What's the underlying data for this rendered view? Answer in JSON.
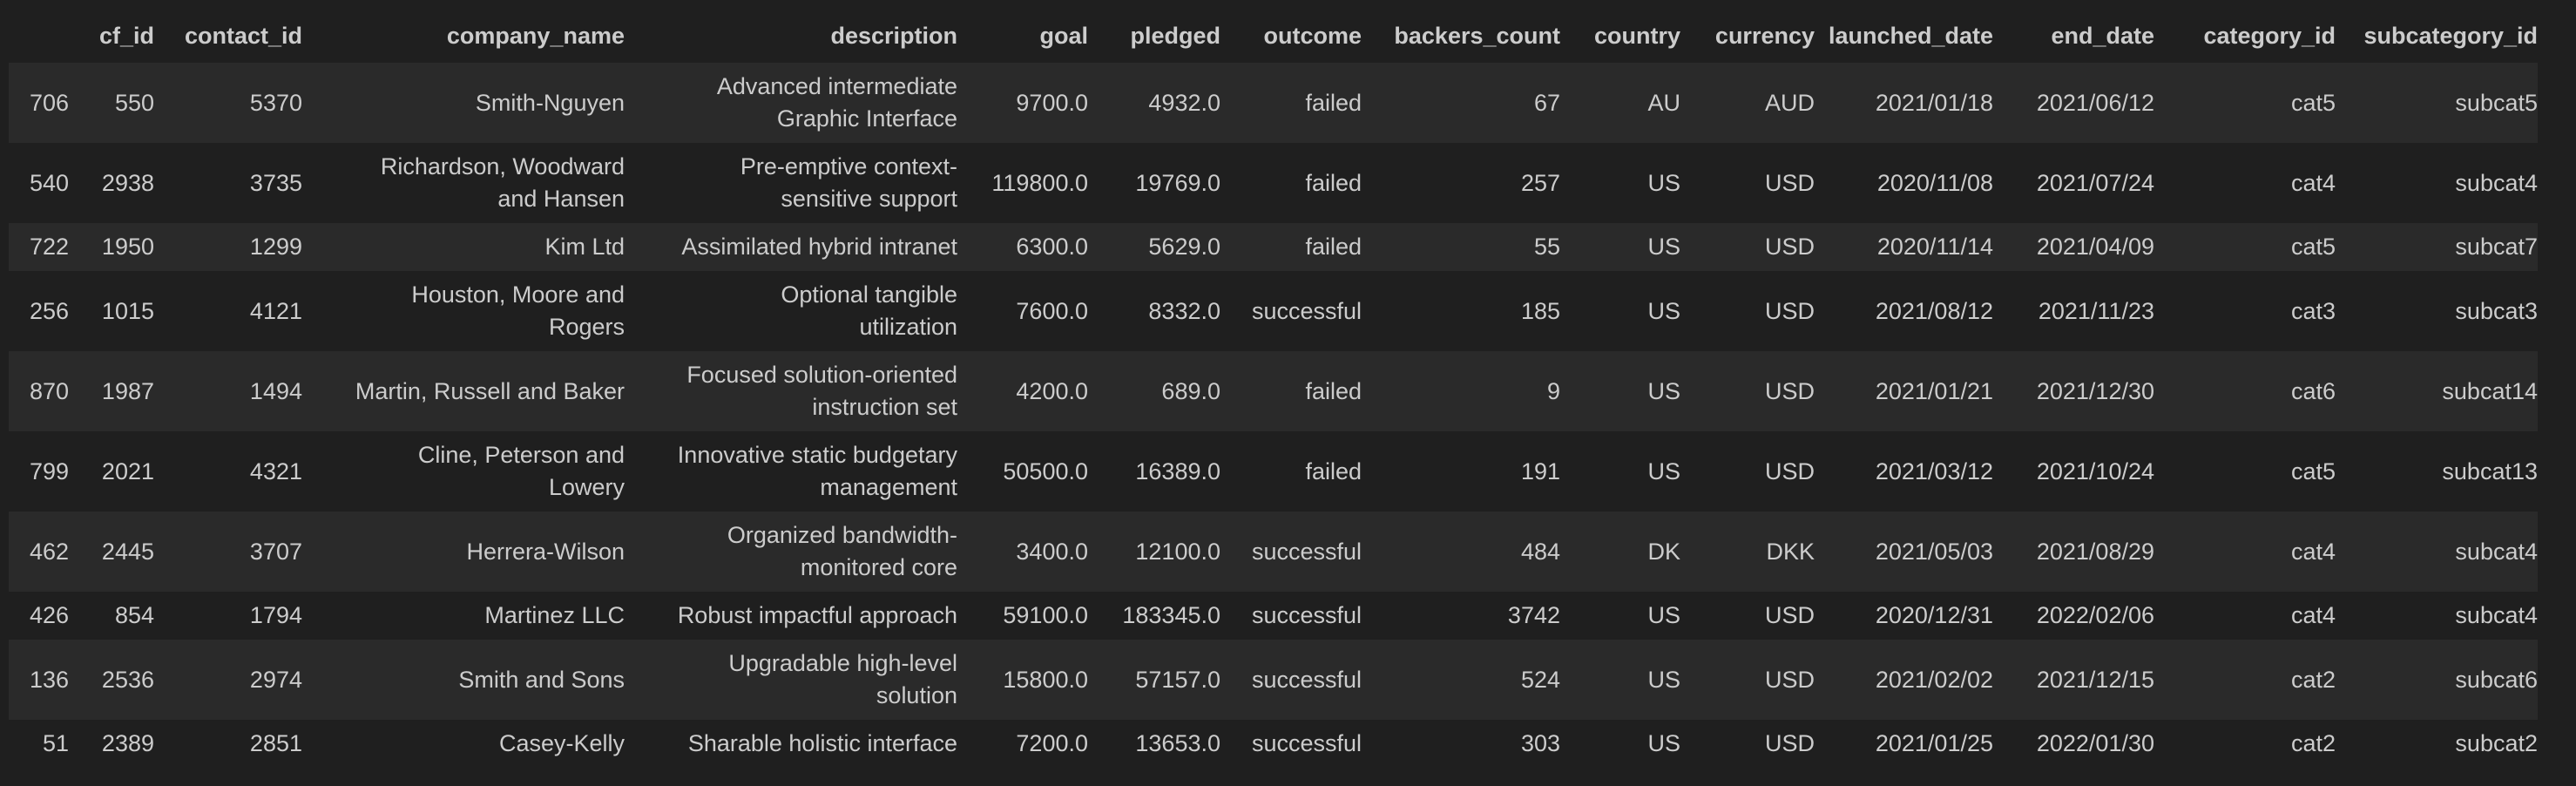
{
  "columns": {
    "index": "",
    "cf_id": "cf_id",
    "contact_id": "contact_id",
    "company_name": "company_name",
    "description": "description",
    "goal": "goal",
    "pledged": "pledged",
    "outcome": "outcome",
    "backers_count": "backers_count",
    "country": "country",
    "currency": "currency",
    "launched_date": "launched_date",
    "end_date": "end_date",
    "category_id": "category_id",
    "subcategory_id": "subcategory_id"
  },
  "rows": [
    {
      "index": "706",
      "cf_id": "550",
      "contact_id": "5370",
      "company_name": [
        "Smith-Nguyen"
      ],
      "description": [
        "Advanced intermediate",
        "Graphic Interface"
      ],
      "goal": "9700.0",
      "pledged": "4932.0",
      "outcome": "failed",
      "backers_count": "67",
      "country": "AU",
      "currency": "AUD",
      "launched_date": "2021/01/18",
      "end_date": "2021/06/12",
      "category_id": "cat5",
      "subcategory_id": "subcat5"
    },
    {
      "index": "540",
      "cf_id": "2938",
      "contact_id": "3735",
      "company_name": [
        "Richardson, Woodward",
        "and Hansen"
      ],
      "description": [
        "Pre-emptive context-",
        "sensitive support"
      ],
      "goal": "119800.0",
      "pledged": "19769.0",
      "outcome": "failed",
      "backers_count": "257",
      "country": "US",
      "currency": "USD",
      "launched_date": "2020/11/08",
      "end_date": "2021/07/24",
      "category_id": "cat4",
      "subcategory_id": "subcat4"
    },
    {
      "index": "722",
      "cf_id": "1950",
      "contact_id": "1299",
      "company_name": [
        "Kim Ltd"
      ],
      "description": [
        "Assimilated hybrid intranet"
      ],
      "goal": "6300.0",
      "pledged": "5629.0",
      "outcome": "failed",
      "backers_count": "55",
      "country": "US",
      "currency": "USD",
      "launched_date": "2020/11/14",
      "end_date": "2021/04/09",
      "category_id": "cat5",
      "subcategory_id": "subcat7"
    },
    {
      "index": "256",
      "cf_id": "1015",
      "contact_id": "4121",
      "company_name": [
        "Houston, Moore and",
        "Rogers"
      ],
      "description": [
        "Optional tangible",
        "utilization"
      ],
      "goal": "7600.0",
      "pledged": "8332.0",
      "outcome": "successful",
      "backers_count": "185",
      "country": "US",
      "currency": "USD",
      "launched_date": "2021/08/12",
      "end_date": "2021/11/23",
      "category_id": "cat3",
      "subcategory_id": "subcat3"
    },
    {
      "index": "870",
      "cf_id": "1987",
      "contact_id": "1494",
      "company_name": [
        "Martin, Russell and Baker"
      ],
      "description": [
        "Focused solution-oriented",
        "instruction set"
      ],
      "goal": "4200.0",
      "pledged": "689.0",
      "outcome": "failed",
      "backers_count": "9",
      "country": "US",
      "currency": "USD",
      "launched_date": "2021/01/21",
      "end_date": "2021/12/30",
      "category_id": "cat6",
      "subcategory_id": "subcat14"
    },
    {
      "index": "799",
      "cf_id": "2021",
      "contact_id": "4321",
      "company_name": [
        "Cline, Peterson and",
        "Lowery"
      ],
      "description": [
        "Innovative static budgetary",
        "management"
      ],
      "goal": "50500.0",
      "pledged": "16389.0",
      "outcome": "failed",
      "backers_count": "191",
      "country": "US",
      "currency": "USD",
      "launched_date": "2021/03/12",
      "end_date": "2021/10/24",
      "category_id": "cat5",
      "subcategory_id": "subcat13"
    },
    {
      "index": "462",
      "cf_id": "2445",
      "contact_id": "3707",
      "company_name": [
        "Herrera-Wilson"
      ],
      "description": [
        "Organized bandwidth-",
        "monitored core"
      ],
      "goal": "3400.0",
      "pledged": "12100.0",
      "outcome": "successful",
      "backers_count": "484",
      "country": "DK",
      "currency": "DKK",
      "launched_date": "2021/05/03",
      "end_date": "2021/08/29",
      "category_id": "cat4",
      "subcategory_id": "subcat4"
    },
    {
      "index": "426",
      "cf_id": "854",
      "contact_id": "1794",
      "company_name": [
        "Martinez LLC"
      ],
      "description": [
        "Robust impactful approach"
      ],
      "goal": "59100.0",
      "pledged": "183345.0",
      "outcome": "successful",
      "backers_count": "3742",
      "country": "US",
      "currency": "USD",
      "launched_date": "2020/12/31",
      "end_date": "2022/02/06",
      "category_id": "cat4",
      "subcategory_id": "subcat4"
    },
    {
      "index": "136",
      "cf_id": "2536",
      "contact_id": "2974",
      "company_name": [
        "Smith and Sons"
      ],
      "description": [
        "Upgradable high-level",
        "solution"
      ],
      "goal": "15800.0",
      "pledged": "57157.0",
      "outcome": "successful",
      "backers_count": "524",
      "country": "US",
      "currency": "USD",
      "launched_date": "2021/02/02",
      "end_date": "2021/12/15",
      "category_id": "cat2",
      "subcategory_id": "subcat6"
    },
    {
      "index": "51",
      "cf_id": "2389",
      "contact_id": "2851",
      "company_name": [
        "Casey-Kelly"
      ],
      "description": [
        "Sharable holistic interface"
      ],
      "goal": "7200.0",
      "pledged": "13653.0",
      "outcome": "successful",
      "backers_count": "303",
      "country": "US",
      "currency": "USD",
      "launched_date": "2021/01/25",
      "end_date": "2022/01/30",
      "category_id": "cat2",
      "subcategory_id": "subcat2"
    }
  ]
}
